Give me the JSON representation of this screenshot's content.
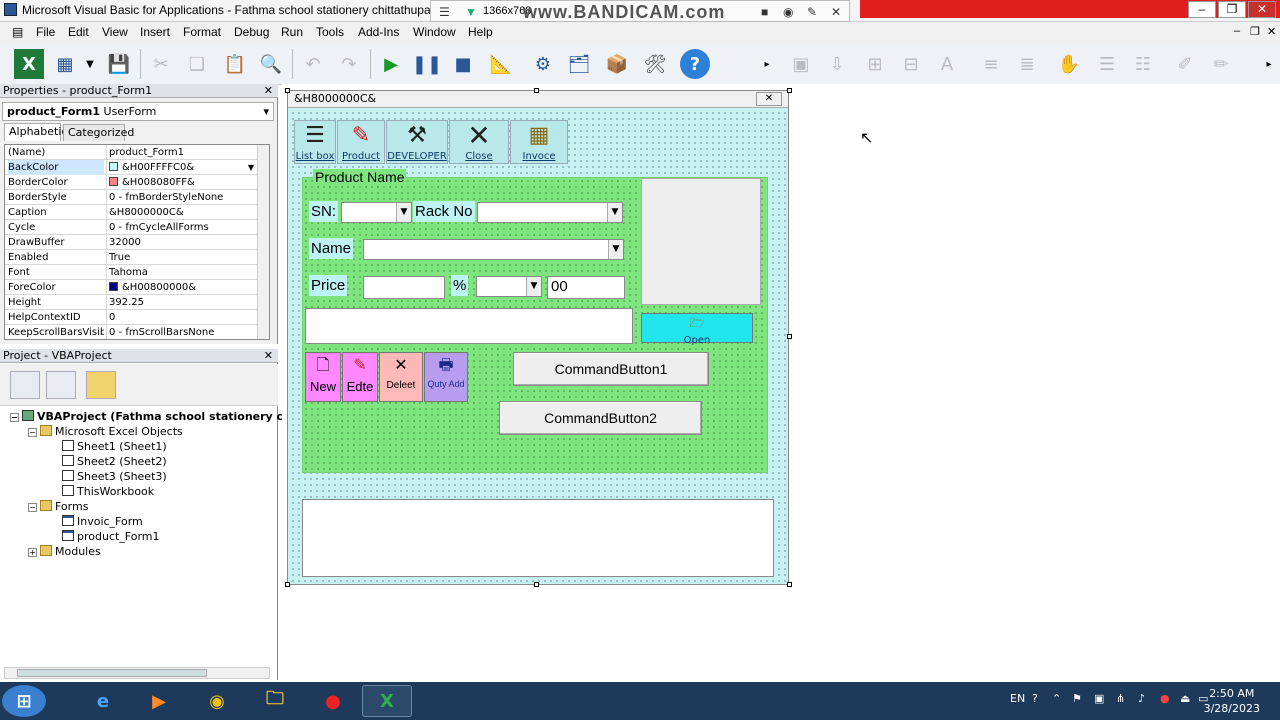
{
  "window": {
    "title": "Microsoft Visual Basic for Applications - Fathma school stationery chittathupara",
    "resolution_text": "1366x768",
    "recorder_brand": "www.BANDICAM.com"
  },
  "menu": [
    "File",
    "Edit",
    "View",
    "Insert",
    "Format",
    "Debug",
    "Run",
    "Tools",
    "Add-Ins",
    "Window",
    "Help"
  ],
  "properties_panel": {
    "header": "Properties - product_Form1",
    "object_name": "product_Form1",
    "object_type": "UserForm",
    "tabs": [
      "Alphabetic",
      "Categorized"
    ],
    "rows": [
      {
        "name": "(Name)",
        "value": "product_Form1"
      },
      {
        "name": "BackColor",
        "value": "&H00FFFFC0&",
        "swatch": "#c0ffff"
      },
      {
        "name": "BorderColor",
        "value": "&H008080FF&",
        "swatch": "#ff8080"
      },
      {
        "name": "BorderStyle",
        "value": "0 - fmBorderStyleNone"
      },
      {
        "name": "Caption",
        "value": "&H8000000C&"
      },
      {
        "name": "Cycle",
        "value": "0 - fmCycleAllForms"
      },
      {
        "name": "DrawBuffer",
        "value": "32000"
      },
      {
        "name": "Enabled",
        "value": "True"
      },
      {
        "name": "Font",
        "value": "Tahoma"
      },
      {
        "name": "ForeColor",
        "value": "&H00800000&",
        "swatch": "#000080"
      },
      {
        "name": "Height",
        "value": "392.25"
      },
      {
        "name": "HelpContextID",
        "value": "0"
      },
      {
        "name": "KeepScrollBarsVisible",
        "value": "0 - fmScrollBarsNone"
      }
    ]
  },
  "project_panel": {
    "header": "Project - VBAProject",
    "root": "VBAProject (Fathma school stationery chitt",
    "excel_objects_label": "Microsoft Excel Objects",
    "sheets": [
      "Sheet1 (Sheet1)",
      "Sheet2 (Sheet2)",
      "Sheet3 (Sheet3)",
      "ThisWorkbook"
    ],
    "forms_label": "Forms",
    "forms": [
      "Invoic_Form",
      "product_Form1"
    ],
    "modules_label": "Modules"
  },
  "userform": {
    "caption": "&H8000000C&",
    "top_buttons": [
      {
        "label": "List box",
        "icon": "list-icon"
      },
      {
        "label": "Product",
        "icon": "product-icon"
      },
      {
        "label": "DEVELOPER",
        "icon": "hammer-icon"
      },
      {
        "label": "Close",
        "icon": "close-icon"
      },
      {
        "label": "Invoce",
        "icon": "calculator-icon"
      }
    ],
    "frame_caption": "Product Name",
    "labels": {
      "sn": "SN:",
      "rack": "Rack No",
      "name": "Name",
      "price": "Price",
      "percent": "%"
    },
    "price_textbox_value": "00",
    "open_button": "Open",
    "action_buttons": [
      {
        "label": "New",
        "color": "#ff88ff"
      },
      {
        "label": "Edte",
        "color": "#ff88ff"
      },
      {
        "label": "Deleet",
        "color": "#ffb8b8"
      },
      {
        "label": "Quty Add",
        "color": "#b89cf0"
      }
    ],
    "command_buttons": [
      "CommandButton1",
      "CommandButton2"
    ]
  },
  "taskbar": {
    "language": "EN",
    "time": "2:50 AM",
    "date": "3/28/2023",
    "apps": [
      "internet-explorer-icon",
      "media-player-icon",
      "chrome-icon",
      "explorer-icon",
      "record-icon",
      "excel-icon"
    ]
  }
}
